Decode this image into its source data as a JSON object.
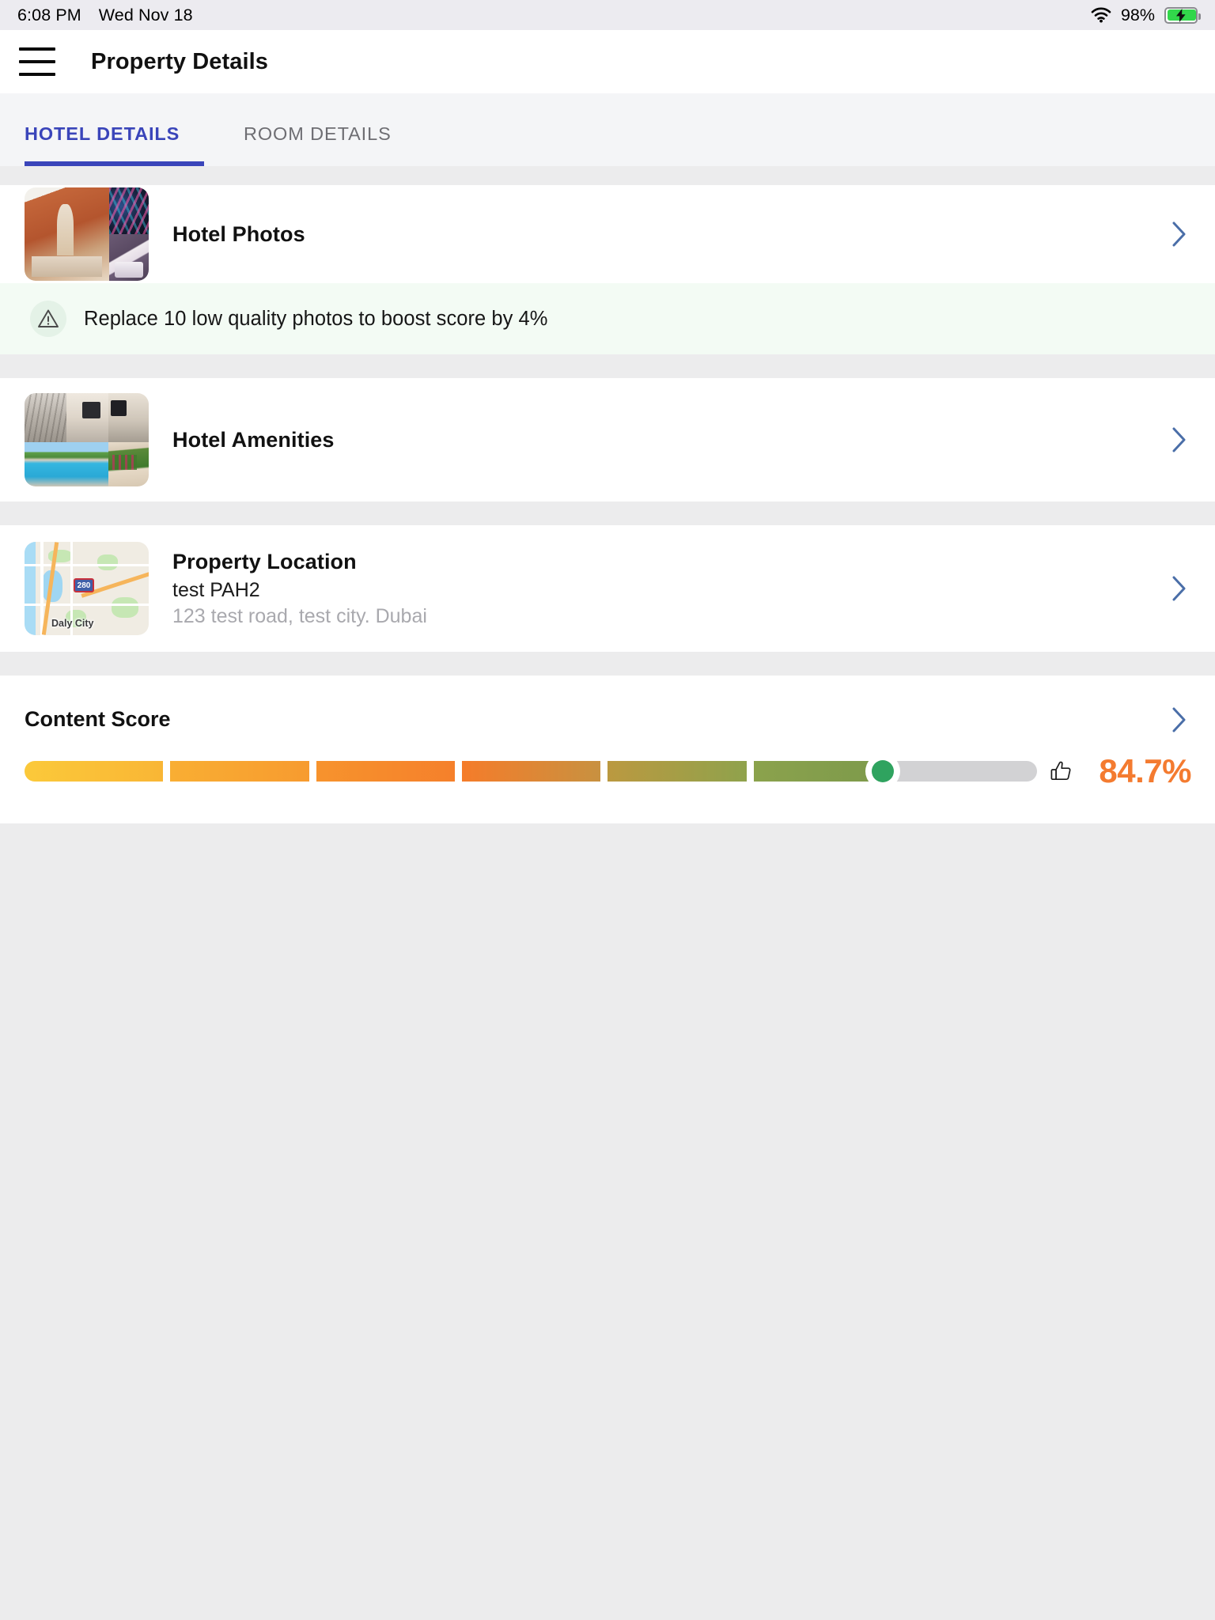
{
  "status_bar": {
    "time": "6:08 PM",
    "date": "Wed Nov 18",
    "battery_percent": "98%",
    "wifi_icon": "wifi-icon",
    "battery_icon": "battery-charging-icon"
  },
  "app_bar": {
    "menu_icon": "hamburger-menu-icon",
    "title": "Property Details"
  },
  "tabs": [
    {
      "label": "HOTEL DETAILS",
      "active": true
    },
    {
      "label": "ROOM DETAILS",
      "active": false
    }
  ],
  "sections": {
    "hotel_photos": {
      "title": "Hotel Photos",
      "thumbnail_name": "hotel-photos-collage",
      "chevron_icon": "chevron-right-icon",
      "tip": {
        "icon": "warning-triangle-icon",
        "text": "Replace 10 low quality photos to boost score by 4%"
      }
    },
    "hotel_amenities": {
      "title": "Hotel Amenities",
      "thumbnail_name": "hotel-amenities-collage",
      "chevron_icon": "chevron-right-icon"
    },
    "property_location": {
      "title": "Property Location",
      "name": "test PAH2",
      "address": "123 test road, test city. Dubai",
      "map_label": "Daly City",
      "map_highway_shield": "280",
      "chevron_icon": "chevron-right-icon"
    },
    "content_score": {
      "title": "Content Score",
      "chevron_icon": "chevron-right-icon",
      "value": "84.7%",
      "thumbs_up_icon": "thumbs-up-icon",
      "marker_icon": "score-marker-dot"
    }
  },
  "colors": {
    "tab_active": "#3a45ba",
    "score_value": "#f47b30",
    "marker_green": "#2fa35f",
    "tip_background": "#f3fbf4",
    "battery_green": "#32d74b"
  },
  "chart_data": {
    "type": "bar",
    "title": "Content Score",
    "value": 84.7,
    "unit": "%",
    "xlim": [
      0,
      100
    ],
    "marker_position": 84.7,
    "segments": [
      {
        "from": 0,
        "to": 13.7,
        "color_start": "#fbc93a",
        "color_end": "#f9b635"
      },
      {
        "from": 14.4,
        "to": 28.1,
        "color_start": "#f9ae33",
        "color_end": "#f79b2f"
      },
      {
        "from": 28.8,
        "to": 42.5,
        "color_start": "#f7932d",
        "color_end": "#f5802b"
      },
      {
        "from": 43.2,
        "to": 56.9,
        "color_start": "#f57c2a",
        "color_end": "#c89140"
      },
      {
        "from": 57.6,
        "to": 71.3,
        "color_start": "#bb9940",
        "color_end": "#8fa24c"
      },
      {
        "from": 72.0,
        "to": 84.7,
        "color_start": "#8ba24c",
        "color_end": "#7d9a4b"
      },
      {
        "from": 84.7,
        "to": 100,
        "color_start": "#d2d2d4",
        "color_end": "#d2d2d4"
      }
    ]
  }
}
